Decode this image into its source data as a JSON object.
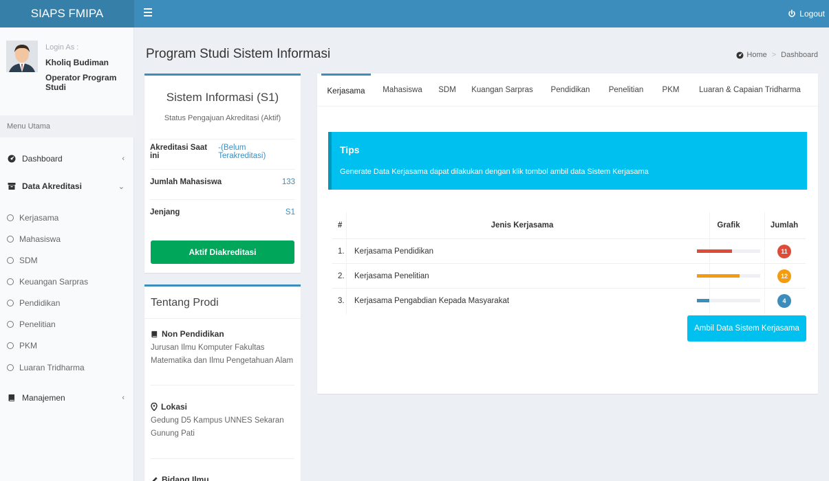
{
  "app": {
    "logo_text": "SIAPS FMIPA"
  },
  "topbar": {
    "logout_label": "Logout"
  },
  "user": {
    "login_as": "Login As :",
    "name": "Kholiq Budiman",
    "role": "Operator Program Studi"
  },
  "sidebar": {
    "header": "Menu Utama",
    "items": [
      {
        "label": "Dashboard",
        "icon": "dashboard-icon"
      },
      {
        "label": "Data Akreditasi",
        "icon": "archive-icon"
      },
      {
        "label": "Manajemen",
        "icon": "book-icon"
      }
    ],
    "subitems": [
      "Kerjasama",
      "Mahasiswa",
      "SDM",
      "Keuangan Sarpras",
      "Pendidikan",
      "Penelitian",
      "PKM",
      "Luaran Tridharma"
    ]
  },
  "page": {
    "title": "Program Studi Sistem Informasi"
  },
  "breadcrumb": {
    "home": "Home",
    "current": "Dashboard"
  },
  "prodi": {
    "name": "Sistem Informasi (S1)",
    "status": "Status Pengajuan Akreditasi (Aktif)",
    "rows": [
      {
        "key": "Akreditasi Saat ini",
        "value": "-(Belum Terakreditasi)"
      },
      {
        "key": "Jumlah Mahasiswa",
        "value": "133"
      },
      {
        "key": "Jenjang",
        "value": "S1"
      }
    ],
    "button": "Aktif Diakreditasi"
  },
  "about": {
    "title": "Tentang Prodi",
    "sections": [
      {
        "title": "Non Pendidikan",
        "desc": "Jurusan Ilmu Komputer Fakultas Matematika dan Ilmu Pengetahuan Alam"
      },
      {
        "title": "Lokasi",
        "desc": "Gedung D5 Kampus UNNES Sekaran Gunung Pati"
      },
      {
        "title": "Bidang Ilmu",
        "desc": ""
      }
    ]
  },
  "tabs": [
    "Kerjasama",
    "Mahasiswa",
    "SDM",
    "Kuangan Sarpras",
    "Pendidikan",
    "Penelitian",
    "PKM",
    "Luaran & Capaian Tridharma"
  ],
  "tips": {
    "title": "Tips",
    "desc": "Generate Data Kerjasama dapat dilakukan dengan klik tombol ambil data Sistem Kerjasama"
  },
  "table": {
    "headers": {
      "no": "#",
      "name": "Jenis Kerjasama",
      "grafik": "Grafik",
      "jumlah": "Jumlah"
    },
    "rows": [
      {
        "no": "1.",
        "name": "Kerjasama Pendidikan",
        "bar_fraction": 0.55,
        "color": "#dd4b39",
        "count": "11"
      },
      {
        "no": "2.",
        "name": "Kerjasama Penelitian",
        "bar_fraction": 0.67,
        "color": "#f39c12",
        "count": "12"
      },
      {
        "no": "3.",
        "name": "Kerjasama Pengabdian Kepada Masyarakat",
        "bar_fraction": 0.2,
        "color": "#3c8dbc",
        "count": "4"
      }
    ]
  },
  "action_button": "Ambil Data Sistem Kerjasama"
}
